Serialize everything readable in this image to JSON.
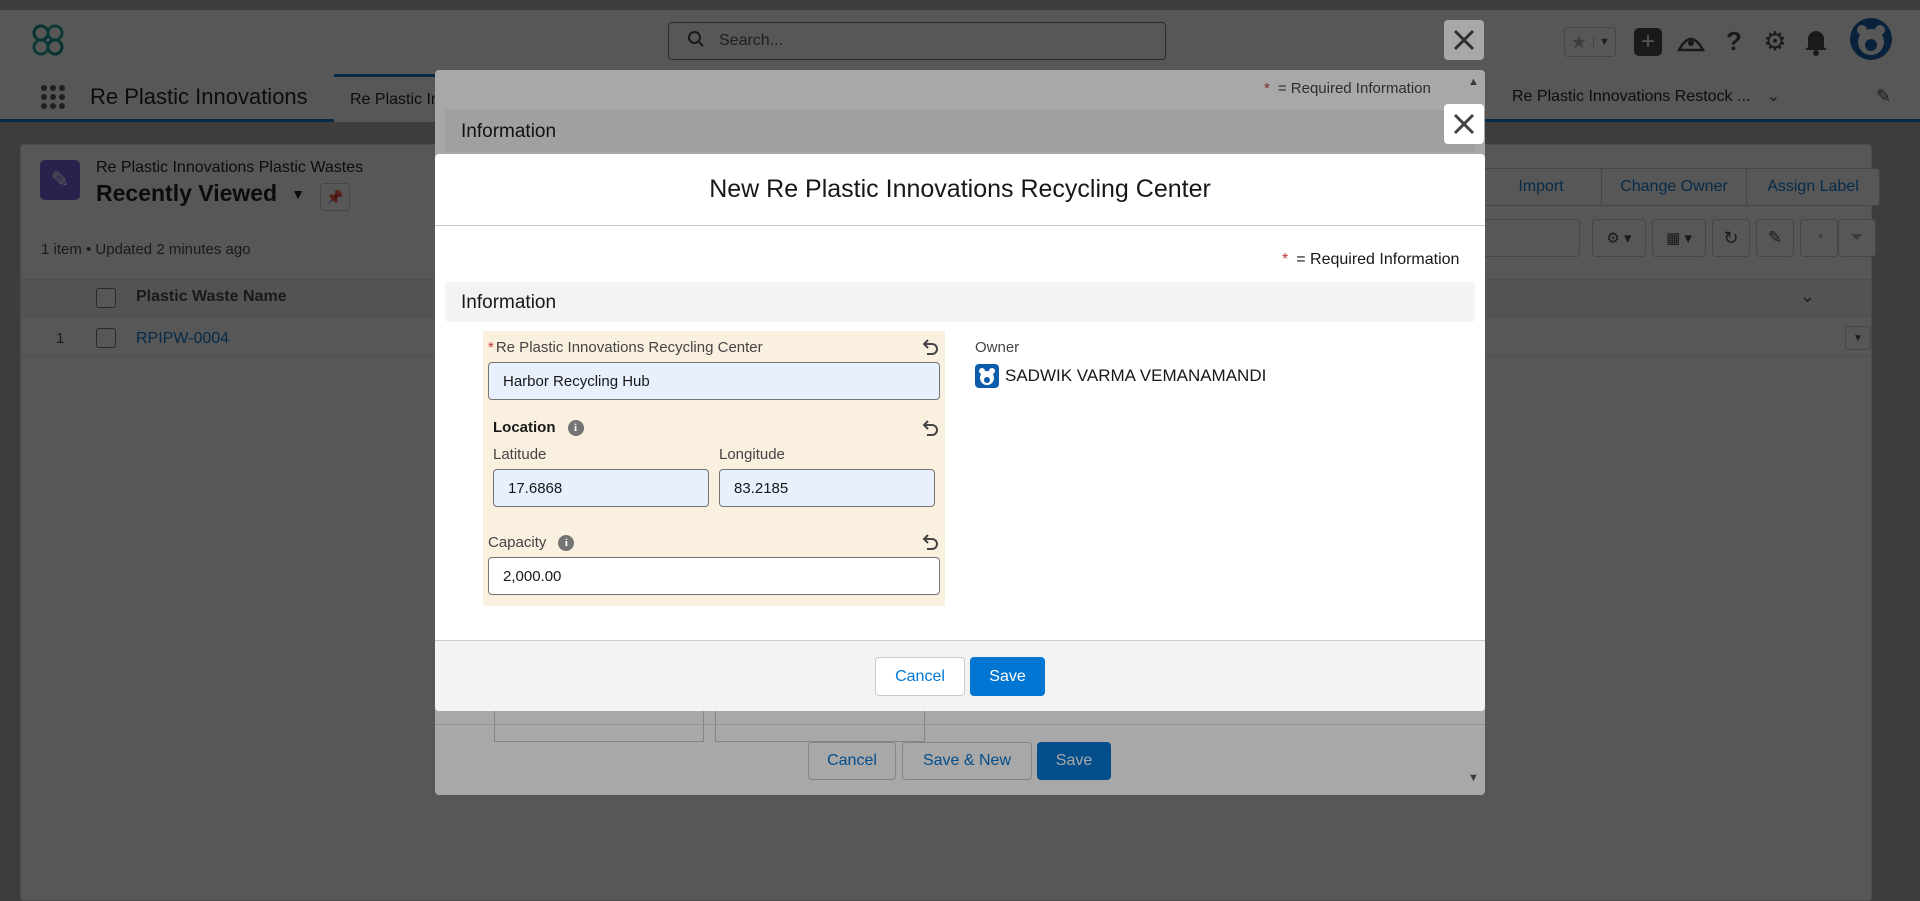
{
  "global_header": {
    "search_placeholder": "Search..."
  },
  "nav": {
    "app_name": "Re Plastic Innovations",
    "tab_partial": "Re Plastic In",
    "tab_right": "Re Plastic Innovations Restock ..."
  },
  "list_view": {
    "object_name": "Re Plastic Innovations Plastic Wastes",
    "view_name": "Recently Viewed",
    "status": "1 item • Updated 2 minutes ago",
    "buttons": [
      "Import",
      "Change Owner",
      "Assign Label"
    ],
    "column_header": "Plastic Waste Name",
    "rows": [
      {
        "num": "1",
        "name": "RPIPW-0004"
      }
    ]
  },
  "back_modal": {
    "required_note": "= Required Information",
    "section": "Information",
    "cancel_label": "Cancel",
    "save_new_label": "Save & New",
    "save_label": "Save"
  },
  "modal": {
    "title": "New Re Plastic Innovations Recycling Center",
    "required_asterisk": "*",
    "required_note": "= Required Information",
    "section": "Information",
    "name_field": {
      "label": "Re Plastic Innovations Recycling Center",
      "value": "Harbor Recycling Hub"
    },
    "location": {
      "label": "Location",
      "latitude_label": "Latitude",
      "latitude_value": "17.6868",
      "longitude_label": "Longitude",
      "longitude_value": "83.2185"
    },
    "capacity": {
      "label": "Capacity",
      "value": "2,000.00"
    },
    "owner": {
      "label": "Owner",
      "value": "SADWIK VARMA VEMANAMANDI"
    },
    "cancel_label": "Cancel",
    "save_label": "Save"
  },
  "colors": {
    "brand": "#0176d3",
    "edited_field_bg": "#faf0e0",
    "autofill_bg": "#e8f0fe"
  }
}
